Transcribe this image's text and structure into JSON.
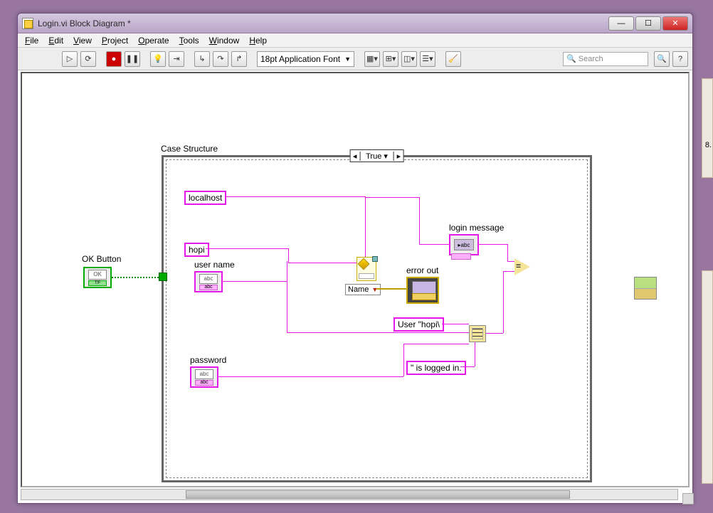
{
  "window": {
    "title": "Login.vi Block Diagram *"
  },
  "menus": {
    "file": "File",
    "edit": "Edit",
    "view": "View",
    "project": "Project",
    "operate": "Operate",
    "tools": "Tools",
    "window": "Window",
    "help": "Help"
  },
  "toolbar": {
    "font": "18pt Application Font",
    "search_placeholder": "Search"
  },
  "diagram": {
    "case_label": "Case Structure",
    "case_value": "True",
    "ok_button_label": "OK Button",
    "constants": {
      "localhost": "localhost",
      "hopi": "hopi",
      "user_hopi": "User \"hopi\\",
      "logged_in": "\" is logged in."
    },
    "controls": {
      "user_name": "user name",
      "password": "password"
    },
    "indicators": {
      "login_message": "login message",
      "error_out": "error out"
    },
    "prop_name": "Name",
    "bg_label": "8."
  }
}
